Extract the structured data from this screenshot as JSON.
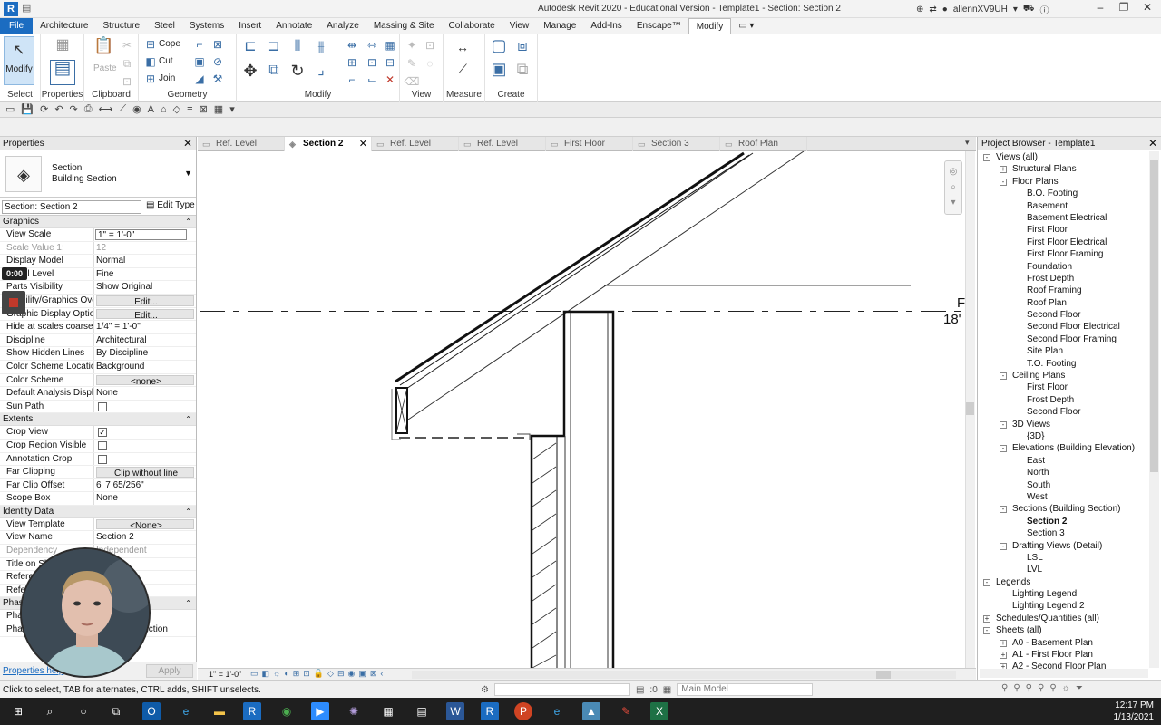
{
  "app": {
    "logo_letter": "R",
    "title": "Autodesk Revit 2020 - Educational Version - Template1 - Section: Section 2",
    "user": "allennXV9UH"
  },
  "menu_tabs": [
    "File",
    "Architecture",
    "Structure",
    "Steel",
    "Systems",
    "Insert",
    "Annotate",
    "Analyze",
    "Massing & Site",
    "Collaborate",
    "View",
    "Manage",
    "Add-Ins",
    "Enscape™",
    "Modify"
  ],
  "ribbon": {
    "modify_btn": "Modify",
    "select_label": "Select",
    "properties_label": "Properties",
    "clipboard_label": "Clipboard",
    "paste_label": "Paste",
    "geometry_label": "Geometry",
    "cope_label": "Cope",
    "cut_label": "Cut",
    "join_label": "Join",
    "modify_label": "Modify",
    "view_label": "View",
    "measure_label": "Measure",
    "create_label": "Create"
  },
  "properties": {
    "title": "Properties",
    "type_name": "Section",
    "type_sub": "Building Section",
    "instance": "Section: Section 2",
    "edit_type": "Edit Type",
    "groups": [
      {
        "name": "Graphics",
        "rows": [
          {
            "k": "View Scale",
            "v": "1\" = 1'-0\"",
            "style": "box"
          },
          {
            "k": "Scale Value    1:",
            "v": "12",
            "style": "dim"
          },
          {
            "k": "Display Model",
            "v": "Normal"
          },
          {
            "k": "Detail Level",
            "v": "Fine"
          },
          {
            "k": "Parts Visibility",
            "v": "Show Original"
          },
          {
            "k": "Visibility/Graphics Ove...",
            "v": "Edit...",
            "style": "btn"
          },
          {
            "k": "Graphic Display Optio...",
            "v": "Edit...",
            "style": "btn"
          },
          {
            "k": "Hide at scales coarser ...",
            "v": "1/4\" = 1'-0\""
          },
          {
            "k": "Discipline",
            "v": "Architectural"
          },
          {
            "k": "Show Hidden Lines",
            "v": "By Discipline"
          },
          {
            "k": "Color Scheme Location",
            "v": "Background"
          },
          {
            "k": "Color Scheme",
            "v": "<none>",
            "style": "btn"
          },
          {
            "k": "Default Analysis Displ...",
            "v": "None"
          },
          {
            "k": "Sun Path",
            "v": "",
            "check": false
          }
        ]
      },
      {
        "name": "Extents",
        "rows": [
          {
            "k": "Crop View",
            "v": "",
            "check": true
          },
          {
            "k": "Crop Region Visible",
            "v": "",
            "check": false
          },
          {
            "k": "Annotation Crop",
            "v": "",
            "check": false
          },
          {
            "k": "Far Clipping",
            "v": "Clip without line",
            "style": "btn"
          },
          {
            "k": "Far Clip Offset",
            "v": "6'  7 65/256\""
          },
          {
            "k": "Scope Box",
            "v": "None"
          }
        ]
      },
      {
        "name": "Identity Data",
        "rows": [
          {
            "k": "View Template",
            "v": "<None>",
            "style": "btn"
          },
          {
            "k": "View Name",
            "v": "Section 2"
          },
          {
            "k": "Dependency",
            "v": "Independent",
            "style": "dim"
          },
          {
            "k": "Title on Sheet",
            "v": ""
          },
          {
            "k": "Referencing Sheet",
            "v": ""
          },
          {
            "k": "Referencing Detail",
            "v": ""
          }
        ]
      },
      {
        "name": "Phasing",
        "rows": [
          {
            "k": "Phase Filter",
            "v": ""
          },
          {
            "k": "Phase",
            "v": "New Construction"
          }
        ]
      }
    ],
    "help_link": "Properties help",
    "apply": "Apply"
  },
  "recording": {
    "timer": "0:00"
  },
  "view_tabs": [
    {
      "label": "Ref. Level",
      "active": false
    },
    {
      "label": "Section 2",
      "active": true
    },
    {
      "label": "Ref. Level",
      "active": false
    },
    {
      "label": "Ref. Level",
      "active": false
    },
    {
      "label": "First Floor",
      "active": false
    },
    {
      "label": "Section 3",
      "active": false
    },
    {
      "label": "Roof Plan",
      "active": false
    }
  ],
  "canvas": {
    "level_letter": "F",
    "level_elev": "18'"
  },
  "view_bar": {
    "scale": "1\" = 1'-0\""
  },
  "project_browser": {
    "title": "Project Browser - Template1",
    "items": [
      {
        "t": "Views (all)",
        "d": 0,
        "tg": "-"
      },
      {
        "t": "Structural Plans",
        "d": 1,
        "tg": "+"
      },
      {
        "t": "Floor Plans",
        "d": 1,
        "tg": "-"
      },
      {
        "t": "B.O. Footing",
        "d": 2
      },
      {
        "t": "Basement",
        "d": 2
      },
      {
        "t": "Basement Electrical",
        "d": 2
      },
      {
        "t": "First Floor",
        "d": 2
      },
      {
        "t": "First Floor Electrical",
        "d": 2
      },
      {
        "t": "First Floor Framing",
        "d": 2
      },
      {
        "t": "Foundation",
        "d": 2
      },
      {
        "t": "Frost Depth",
        "d": 2
      },
      {
        "t": "Roof Framing",
        "d": 2
      },
      {
        "t": "Roof Plan",
        "d": 2
      },
      {
        "t": "Second Floor",
        "d": 2
      },
      {
        "t": "Second Floor Electrical",
        "d": 2
      },
      {
        "t": "Second Floor Framing",
        "d": 2
      },
      {
        "t": "Site Plan",
        "d": 2
      },
      {
        "t": "T.O. Footing",
        "d": 2
      },
      {
        "t": "Ceiling Plans",
        "d": 1,
        "tg": "-"
      },
      {
        "t": "First Floor",
        "d": 2
      },
      {
        "t": "Frost Depth",
        "d": 2
      },
      {
        "t": "Second Floor",
        "d": 2
      },
      {
        "t": "3D Views",
        "d": 1,
        "tg": "-"
      },
      {
        "t": "{3D}",
        "d": 2
      },
      {
        "t": "Elevations (Building Elevation)",
        "d": 1,
        "tg": "-"
      },
      {
        "t": "East",
        "d": 2
      },
      {
        "t": "North",
        "d": 2
      },
      {
        "t": "South",
        "d": 2
      },
      {
        "t": "West",
        "d": 2
      },
      {
        "t": "Sections (Building Section)",
        "d": 1,
        "tg": "-"
      },
      {
        "t": "Section 2",
        "d": 2,
        "bold": true
      },
      {
        "t": "Section 3",
        "d": 2
      },
      {
        "t": "Drafting Views (Detail)",
        "d": 1,
        "tg": "-"
      },
      {
        "t": "LSL",
        "d": 2
      },
      {
        "t": "LVL",
        "d": 2
      },
      {
        "t": "Legends",
        "d": 0,
        "tg": "-"
      },
      {
        "t": "Lighting Legend",
        "d": 1
      },
      {
        "t": "Lighting Legend 2",
        "d": 1
      },
      {
        "t": "Schedules/Quantities (all)",
        "d": 0,
        "tg": "+"
      },
      {
        "t": "Sheets (all)",
        "d": 0,
        "tg": "-"
      },
      {
        "t": "A0 - Basement Plan",
        "d": 1,
        "tg": "+"
      },
      {
        "t": "A1 - First Floor Plan",
        "d": 1,
        "tg": "+"
      },
      {
        "t": "A2 - Second Floor Plan",
        "d": 1,
        "tg": "+"
      }
    ]
  },
  "status": {
    "hint": "Click to select, TAB for alternates, CTRL adds, SHIFT unselects.",
    "zero": ":0",
    "model": "Main Model"
  },
  "taskbar": {
    "time": "12:17 PM",
    "date": "1/13/2021"
  }
}
